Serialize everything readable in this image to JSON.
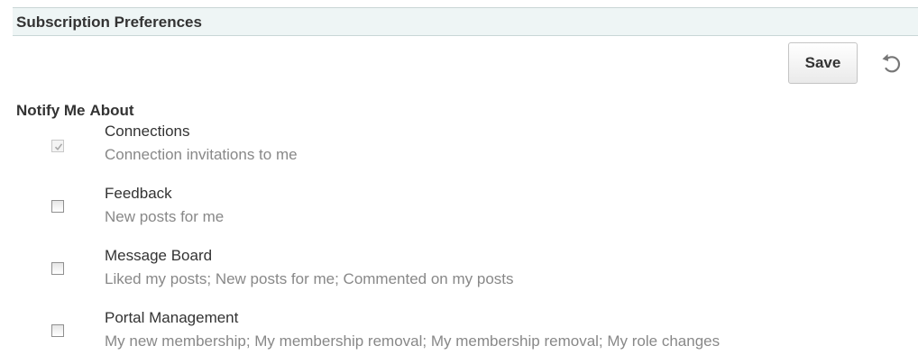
{
  "section": {
    "title": "Subscription Preferences"
  },
  "toolbar": {
    "save_label": "Save",
    "reset_icon": "reset-icon"
  },
  "columns": {
    "notify": "Notify Me",
    "about": "About"
  },
  "preferences": [
    {
      "name": "Connections",
      "description": "Connection invitations to me",
      "checked": true,
      "disabled": true
    },
    {
      "name": "Feedback",
      "description": "New posts for me",
      "checked": false,
      "disabled": false
    },
    {
      "name": "Message Board",
      "description": "Liked my posts; New posts for me; Commented on my posts",
      "checked": false,
      "disabled": false
    },
    {
      "name": "Portal Management",
      "description": "My new membership; My membership removal; My membership removal; My role changes",
      "checked": false,
      "disabled": false
    }
  ],
  "colors": {
    "header_background": "#eef5f5",
    "text": "#333333",
    "description_text": "#888888"
  }
}
